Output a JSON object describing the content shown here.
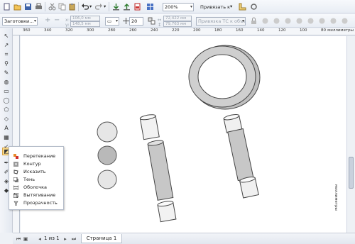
{
  "toolbar_top": {
    "zoom_value": "200%",
    "snap_label": "Привязать к"
  },
  "toolbar_props": {
    "preset_value": "Заготовки...",
    "x_value": "106,0 мм",
    "y_value": "148,5 мм",
    "nudge_value": "20",
    "w_value": "72,422 мм",
    "h_value": "79,763 мм",
    "snap_object": "Привязка ТС к объекту"
  },
  "ruler": {
    "labels": [
      "360",
      "340",
      "320",
      "300",
      "280",
      "260",
      "240",
      "220",
      "200",
      "180",
      "160",
      "140",
      "120",
      "100",
      "80"
    ],
    "unit": "миллиметры"
  },
  "flyout": {
    "items": [
      {
        "label": "Перетекание",
        "icon": "blend-icon"
      },
      {
        "label": "Контур",
        "icon": "contour-icon"
      },
      {
        "label": "Исказить",
        "icon": "distort-icon"
      },
      {
        "label": "Тень",
        "icon": "drop-shadow-icon"
      },
      {
        "label": "Оболочка",
        "icon": "envelope-icon"
      },
      {
        "label": "Вытягивание",
        "icon": "extrude-icon"
      },
      {
        "label": "Прозрачность",
        "icon": "transparency-icon"
      }
    ]
  },
  "pagebar": {
    "page_count": "1 из 1",
    "page_tab": "Страница 1"
  },
  "colors": {
    "accent": "#f7d889",
    "shape_fill_light": "#e4e4e4",
    "shape_fill_mid": "#c4c4c4",
    "shape_stroke": "#555555"
  }
}
